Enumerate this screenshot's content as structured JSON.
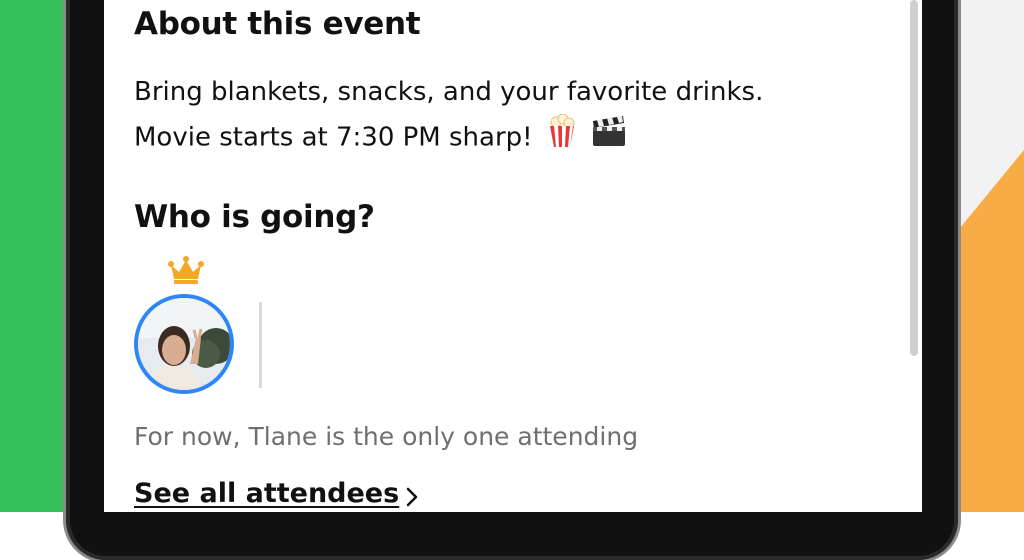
{
  "about": {
    "title": "About this event",
    "description_line1": "Bring blankets, snacks, and your favorite drinks.",
    "description_line2": "Movie starts at 7:30 PM sharp!",
    "emojis": [
      "popcorn-icon",
      "clapper-board-icon"
    ]
  },
  "attendees": {
    "title": "Who is going?",
    "host_badge": "crown-icon",
    "summary": "For now, Tlane is the only one attending",
    "see_all_label": "See all attendees"
  },
  "colors": {
    "avatar_ring": "#2f86f6",
    "crown": "#f5a623",
    "left_bg": "#35c158",
    "right_accent": "#f7ac45"
  }
}
